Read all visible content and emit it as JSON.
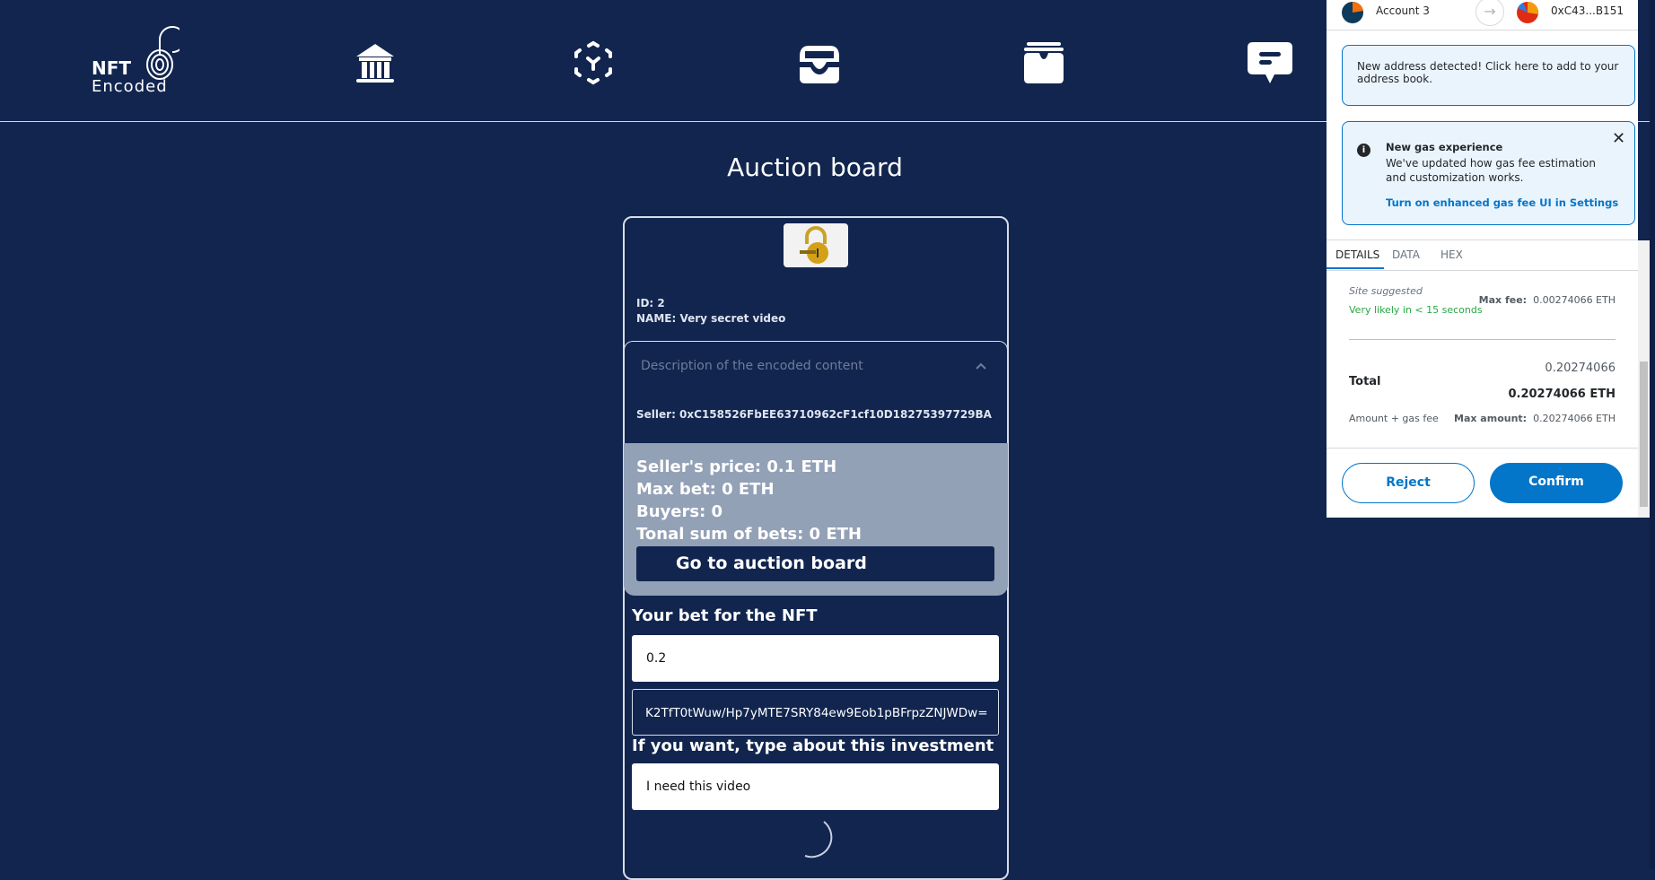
{
  "header": {
    "logo_text_top": "NFT",
    "logo_text_bottom": "Encoded",
    "nav_icons": [
      "bank-icon",
      "ar-cube-icon",
      "inbox-stack-icon",
      "box-archive-icon",
      "chat-message-icon"
    ]
  },
  "page_title": "Auction board",
  "nft": {
    "id": "ID: 2",
    "name": "NAME: Very secret video",
    "description_label": "Description of the encoded content",
    "seller": "Seller: 0xC158526FbEE63710962cF1cf10D18275397729BA",
    "seller_price": "Seller's price: 0.1 ETH",
    "max_bet": "Max bet: 0 ETH",
    "buyers": "Buyers: 0",
    "total_bets": "Tonal sum of bets: 0 ETH",
    "go_button": "Go to auction board"
  },
  "form": {
    "bet_label": "Your bet for the NFT",
    "bet_value": "0.2",
    "key_value": "K2TfT0tWuw/Hp7yMTE7SRY84ew9Eob1pBFrpzZNJWDw=",
    "comment_label": "If you want, type about this investment",
    "comment_value": "I need this video"
  },
  "wallet": {
    "from_account": "Account 3",
    "to_address": "0xC43...B151",
    "address_notice": "New address detected! Click here to add to your address book.",
    "gas_title": "New gas experience",
    "gas_body": "We've updated how gas fee estimation and customization works.",
    "gas_link": "Turn on enhanced gas fee UI in Settings",
    "tabs": [
      "DETAILS",
      "DATA",
      "HEX"
    ],
    "site_suggested": "Site suggested",
    "likely": "Very likely in < 15 seconds",
    "max_fee_label": "Max fee:",
    "max_fee_value": "0.00274066 ETH",
    "total_label": "Total",
    "total_plain": "0.20274066",
    "total_bold": "0.20274066 ETH",
    "amount_gas": "Amount + gas fee",
    "max_amount_label": "Max amount:",
    "max_amount_value": "0.20274066 ETH",
    "reject": "Reject",
    "confirm": "Confirm",
    "colors": {
      "primary": "#0376c9",
      "success": "#28a745",
      "notice_bg": "#eaf4fd"
    }
  },
  "colors": {
    "page_bg": "#11254f",
    "stats_bg": "#93a1b7"
  }
}
